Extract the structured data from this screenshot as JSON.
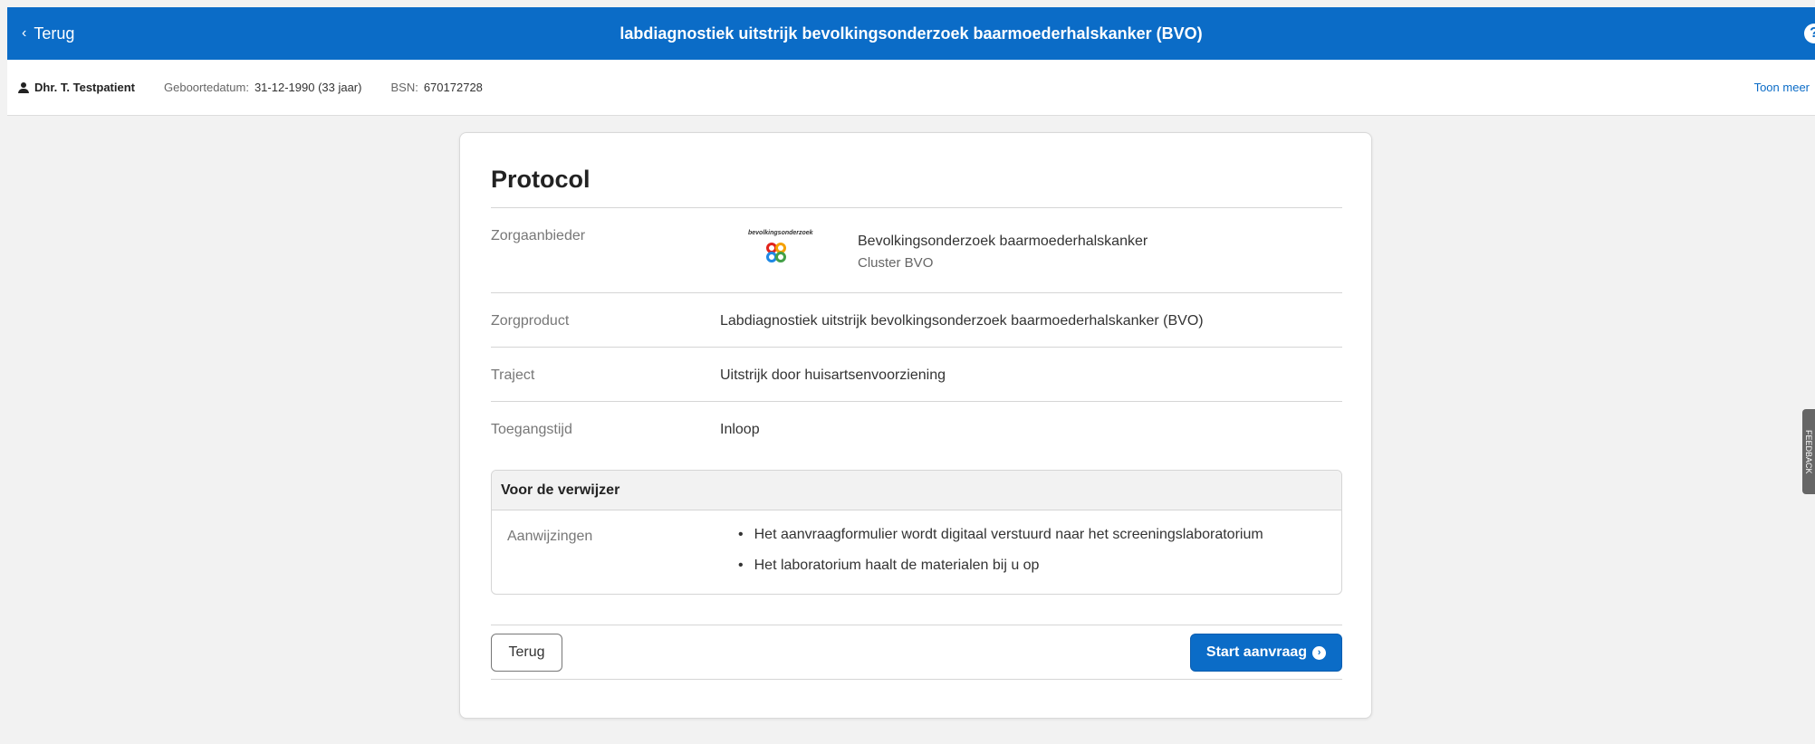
{
  "header": {
    "back_label": "Terug",
    "title": "labdiagnostiek uitstrijk bevolkingsonderzoek baarmoederhalskanker (BVO)",
    "help_symbol": "?"
  },
  "patient": {
    "name": "Dhr. T. Testpatient",
    "dob_label": "Geboortedatum:",
    "dob_value": "31-12-1990 (33 jaar)",
    "bsn_label": "BSN:",
    "bsn_value": "670172728",
    "toon_meer": "Toon meer"
  },
  "feedback_label": "FEEDBACK",
  "protocol": {
    "title": "Protocol",
    "zorgaanbieder_label": "Zorgaanbieder",
    "logo_text": "bevolkingsonderzoek",
    "provider_name": "Bevolkingsonderzoek baarmoederhalskanker",
    "provider_sub": "Cluster BVO",
    "zorgproduct_label": "Zorgproduct",
    "zorgproduct_value": "Labdiagnostiek uitstrijk bevolkingsonderzoek baarmoederhalskanker (BVO)",
    "traject_label": "Traject",
    "traject_value": "Uitstrijk door huisartsenvoorziening",
    "toegangstijd_label": "Toegangstijd",
    "toegangstijd_value": "Inloop"
  },
  "verwijzer": {
    "title": "Voor de verwijzer",
    "aanwijzingen_label": "Aanwijzingen",
    "items": [
      "Het aanvraagformulier wordt digitaal verstuurd naar het screeningslaboratorium",
      "Het laboratorium haalt de materialen bij u op"
    ]
  },
  "actions": {
    "back_label": "Terug",
    "start_label": "Start aanvraag"
  },
  "colors": {
    "primary": "#0b6cc7",
    "background": "#f2f2f2"
  }
}
